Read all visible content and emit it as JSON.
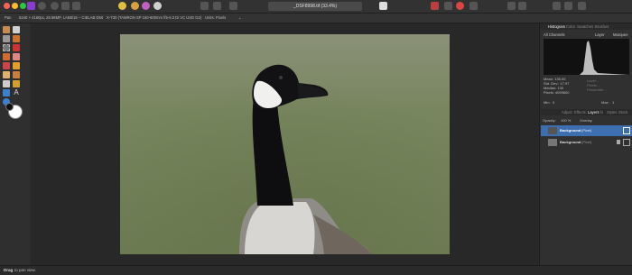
{
  "document": {
    "tab_title": "_DSF8998.tif (33.4%)"
  },
  "context_toolbar": {
    "tool_name": "Pan",
    "image_info": "6240 × 4160px, 26.98MP, LAB8/16 – CIELAB D50",
    "lens_info": "X-T30 (TAMRON SP 150-600mm f/5-6.3 Di VC USD G2)",
    "units_label": "Units:",
    "units_value": "Pixels"
  },
  "histogram_panel": {
    "tabs": [
      "Histogram",
      "Color",
      "Swatches",
      "Brushes"
    ],
    "channel": "All Channels",
    "layer_label": "Layer",
    "marquee_label": "Marquee",
    "stats": {
      "mean": "Mean: 135.55",
      "std_dev": "Std. Dev.: 17.97",
      "median": "Median: 130",
      "pixels": "Pixels: 4059600"
    },
    "stats_right": [
      "Level: -",
      "Pixels: -",
      "Percentile: -"
    ],
    "min_label": "Min:",
    "min_value": "0",
    "max_label": "Max:",
    "max_value": "1"
  },
  "layers_panel": {
    "tabs": [
      "Adjust",
      "Effects",
      "Layers",
      "fx",
      "Styles",
      "Stock"
    ],
    "opacity_label": "Opacity:",
    "opacity_value": "100 %",
    "blend_mode": "Overlay",
    "layers": [
      {
        "name": "Background",
        "type": "(Pixel)",
        "selected": true
      },
      {
        "name": "Background",
        "type": "(Pixel)",
        "selected": false
      }
    ]
  },
  "status_bar": {
    "hint_bold": "Drag",
    "hint_rest": "to pan view."
  },
  "colors": {
    "accent_blue": "#3d6fb0",
    "app_bg": "#2b2b2b",
    "traffic_red": "#fe5f57",
    "traffic_yellow": "#febc2e",
    "traffic_green": "#28c840"
  }
}
